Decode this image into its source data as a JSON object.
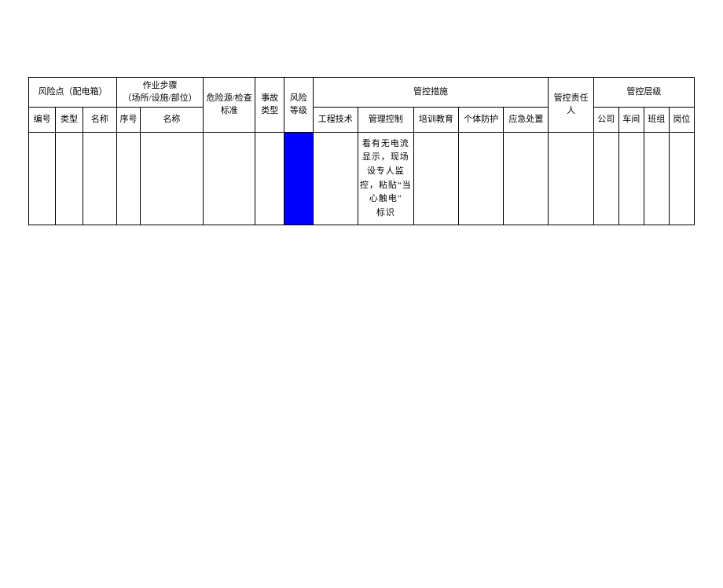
{
  "headers": {
    "risk_point_group": "风险点（配电箱）",
    "work_step_group": "作业步骤\n（场所/设施/部位）",
    "hazard_std": "危险源/检查标准",
    "accident_type": "事故类型",
    "risk_level": "风险等级",
    "control_measures_group": "管控措施",
    "control_responsible": "管控责任人",
    "control_level_group": "管控层级",
    "sub": {
      "num": "编号",
      "type": "类型",
      "name": "名称",
      "seq": "序号",
      "step_name": "名称",
      "eng_tech": "工程技术",
      "mgmt_ctrl": "管理控制",
      "train_edu": "培训教育",
      "ppe": "个体防护",
      "emergency": "应急处置",
      "company": "公司",
      "workshop": "车间",
      "team": "班组",
      "post": "岗位"
    }
  },
  "row": {
    "mgmt_ctrl_text": "看有无电流显示，现场设专人监控，粘贴“当心触电”\n标识"
  }
}
